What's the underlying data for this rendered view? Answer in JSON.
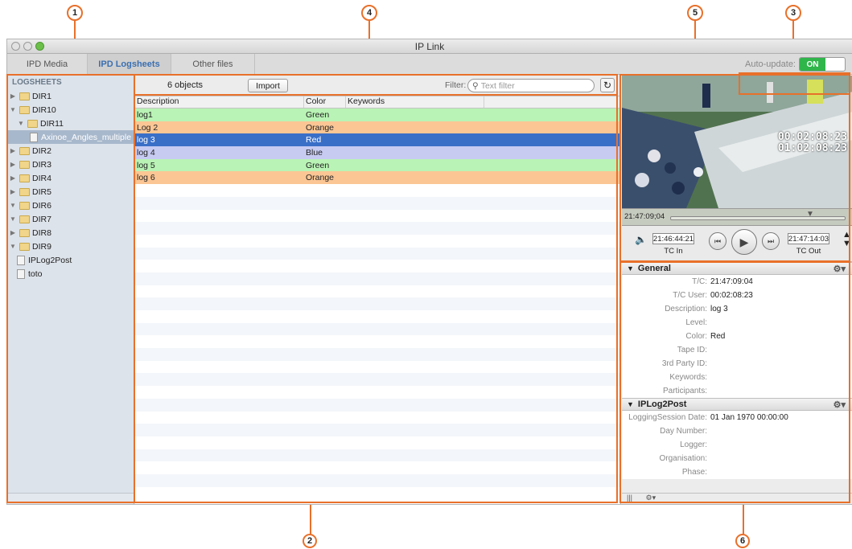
{
  "callouts": [
    "1",
    "2",
    "3",
    "4",
    "5",
    "6"
  ],
  "window": {
    "title": "IP Link"
  },
  "tabs": [
    {
      "label": "IPD Media",
      "active": false
    },
    {
      "label": "IPD Logsheets",
      "active": true
    },
    {
      "label": "Other files",
      "active": false
    }
  ],
  "auto_update": {
    "label": "Auto-update:",
    "state": "ON"
  },
  "sidebar": {
    "header": "LOGSHEETS",
    "items": [
      {
        "label": "DIR1",
        "indent": 0,
        "expanded": false,
        "type": "folder"
      },
      {
        "label": "DIR10",
        "indent": 0,
        "expanded": true,
        "type": "folder"
      },
      {
        "label": "DIR11",
        "indent": 1,
        "expanded": true,
        "type": "folder"
      },
      {
        "label": "Axinoe_Angles_multiple",
        "indent": 2,
        "type": "file",
        "selected": true
      },
      {
        "label": "DIR2",
        "indent": 0,
        "expanded": false,
        "type": "folder"
      },
      {
        "label": "DIR3",
        "indent": 0,
        "expanded": false,
        "type": "folder"
      },
      {
        "label": "DIR4",
        "indent": 0,
        "expanded": false,
        "type": "folder"
      },
      {
        "label": "DIR5",
        "indent": 0,
        "expanded": false,
        "type": "folder"
      },
      {
        "label": "DIR6",
        "indent": 0,
        "expanded": true,
        "type": "folder"
      },
      {
        "label": "DIR7",
        "indent": 0,
        "expanded": true,
        "type": "folder"
      },
      {
        "label": "DIR8",
        "indent": 0,
        "expanded": false,
        "type": "folder"
      },
      {
        "label": "DIR9",
        "indent": 0,
        "expanded": true,
        "type": "folder"
      },
      {
        "label": "IPLog2Post",
        "indent": 0,
        "type": "file"
      },
      {
        "label": "toto",
        "indent": 0,
        "type": "file"
      }
    ]
  },
  "toolbar": {
    "count": "6 objects",
    "import_label": "Import",
    "filter_label": "Filter:",
    "filter_placeholder": "Text filter"
  },
  "table": {
    "columns": [
      "Description",
      "Color",
      "Keywords"
    ],
    "rows": [
      {
        "description": "log1",
        "color": "Green",
        "keywords": "",
        "bg": "#b9f3b5",
        "fg": "#222222"
      },
      {
        "description": "Log 2",
        "color": "Orange",
        "keywords": "",
        "bg": "#fbc694",
        "fg": "#222222"
      },
      {
        "description": "log 3",
        "color": "Red",
        "keywords": "",
        "bg": "#3a6fc8",
        "fg": "#ffffff"
      },
      {
        "description": "log 4",
        "color": "Blue",
        "keywords": "",
        "bg": "#c7cbf2",
        "fg": "#222222"
      },
      {
        "description": "log 5",
        "color": "Green",
        "keywords": "",
        "bg": "#b9f3b5",
        "fg": "#222222"
      },
      {
        "description": "log 6",
        "color": "Orange",
        "keywords": "",
        "bg": "#fbc694",
        "fg": "#222222"
      }
    ]
  },
  "player": {
    "overlay_tc1": "00:02:08:23",
    "overlay_tc2": "01:02:08:23",
    "scrub_tc": "21:47:09;04",
    "tc_in": "21:46:44:21",
    "tc_in_label": "TC In",
    "tc_out": "21:47:14:03",
    "tc_out_label": "TC Out"
  },
  "general": {
    "title": "General",
    "props": [
      {
        "key": "T/C:",
        "value": "21:47:09:04"
      },
      {
        "key": "T/C User:",
        "value": "00:02:08:23"
      },
      {
        "key": "Description:",
        "value": "log 3"
      },
      {
        "key": "Level:",
        "value": ""
      },
      {
        "key": "Color:",
        "value": "Red"
      },
      {
        "key": "Tape ID:",
        "value": ""
      },
      {
        "key": "3rd Party ID:",
        "value": ""
      },
      {
        "key": "Keywords:",
        "value": ""
      },
      {
        "key": "Participants:",
        "value": ""
      }
    ]
  },
  "iplog2post": {
    "title": "IPLog2Post",
    "props": [
      {
        "key": "LoggingSession Date:",
        "value": "01 Jan 1970 00:00:00"
      },
      {
        "key": "Day Number:",
        "value": ""
      },
      {
        "key": "Logger:",
        "value": ""
      },
      {
        "key": "Organisation:",
        "value": ""
      },
      {
        "key": "Phase:",
        "value": ""
      }
    ]
  },
  "colors": {
    "accent": "#e8702a",
    "selection": "#3a6fc8",
    "toggle_on": "#2fb54a"
  }
}
